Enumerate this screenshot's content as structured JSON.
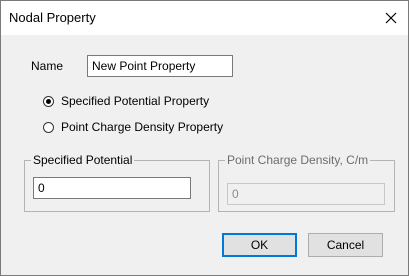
{
  "window": {
    "title": "Nodal Property",
    "close_glyph": "✕"
  },
  "name_field": {
    "label": "Name",
    "value": "New Point Property"
  },
  "property_type": {
    "options": [
      {
        "label": "Specified Potential Property",
        "checked": true
      },
      {
        "label": "Point Charge Density Property",
        "checked": false
      }
    ]
  },
  "specified_potential": {
    "legend": "Specified Potential",
    "value": "0"
  },
  "point_charge_density": {
    "legend": "Point Charge Density, C/m",
    "value": "0",
    "enabled": false
  },
  "buttons": {
    "ok_label": "OK",
    "cancel_label": "Cancel"
  }
}
